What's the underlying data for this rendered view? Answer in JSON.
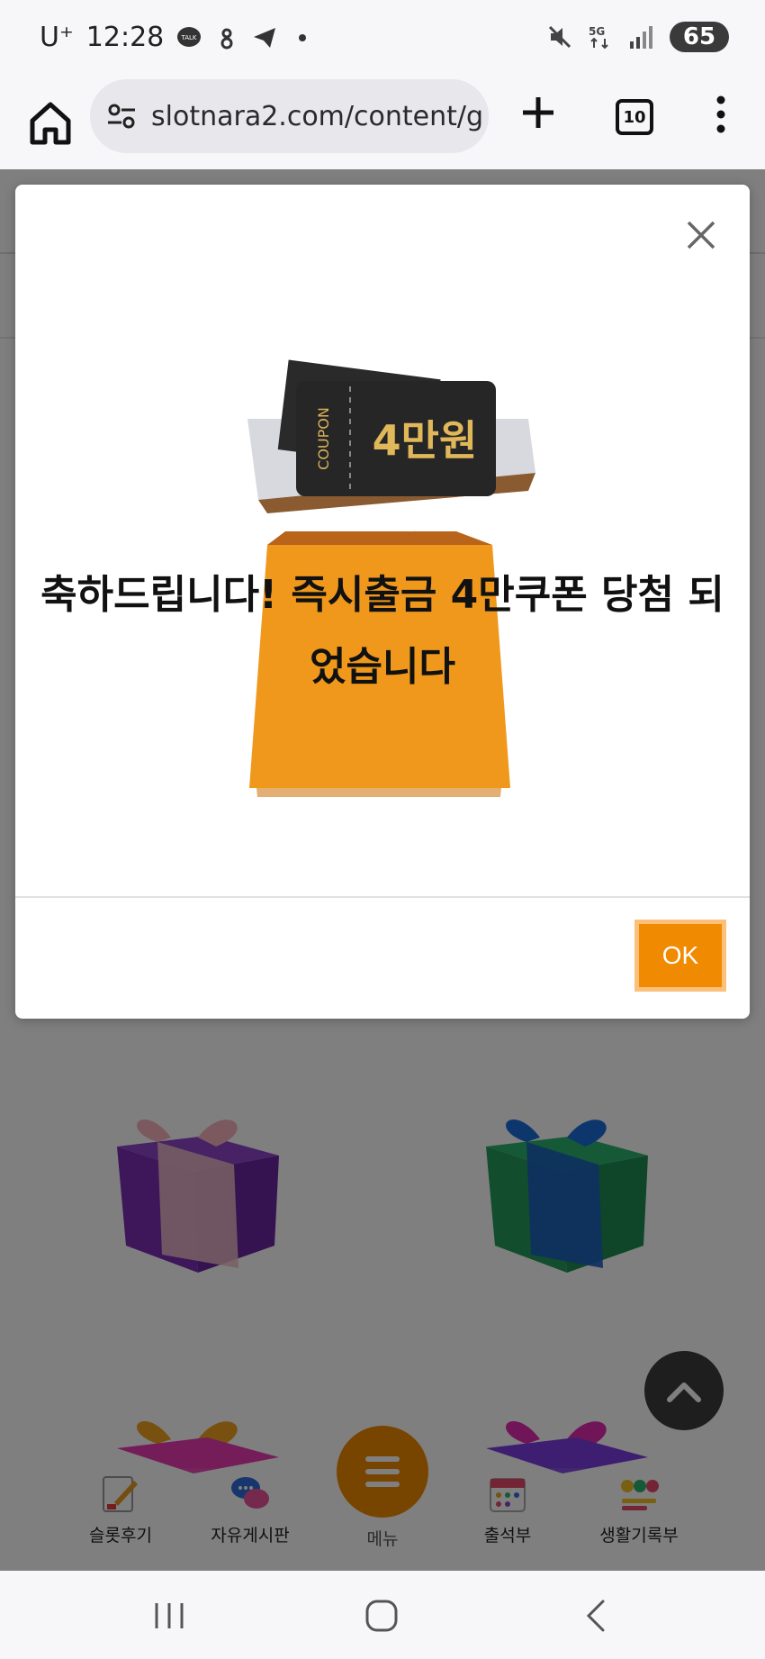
{
  "status_bar": {
    "carrier": "U⁺",
    "time": "12:28",
    "battery": "65",
    "network": "5G"
  },
  "browser": {
    "url": "slotnara2.com/content/g",
    "tab_count": "10",
    "icons": [
      "home-icon",
      "site-settings-icon",
      "new-tab-icon",
      "tabs-icon",
      "more-icon"
    ]
  },
  "modal": {
    "coupon_label": "COUPON",
    "coupon_value": "4만원",
    "message": "축하드립니다! 즉시출금 4만쿠폰 당첨 되었습니다",
    "ok_label": "OK"
  },
  "bottom_nav": {
    "items": [
      {
        "label": "슬롯후기",
        "icon": "review-icon"
      },
      {
        "label": "자유게시판",
        "icon": "chat-icon"
      },
      {
        "label": "메뉴",
        "icon": "menu-icon"
      },
      {
        "label": "출석부",
        "icon": "calendar-icon"
      },
      {
        "label": "생활기록부",
        "icon": "emoji-icon"
      }
    ]
  },
  "colors": {
    "accent": "#f08a00",
    "overlay": "#000000"
  }
}
